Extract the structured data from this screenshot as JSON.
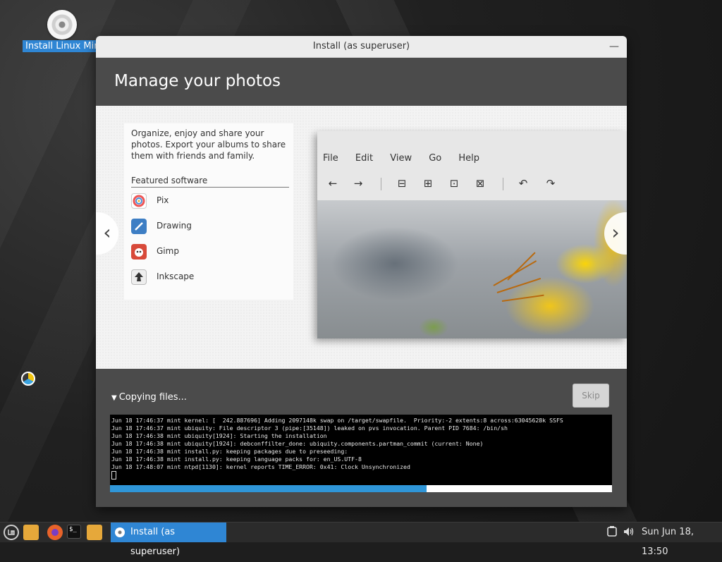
{
  "desktop": {
    "icon_label": "Install Linux Mint"
  },
  "window": {
    "title": "Install (as superuser)",
    "minimize_label": "—",
    "header_title": "Manage your photos"
  },
  "slide": {
    "description": "Organize, enjoy and share your photos. Export your albums to share them with friends and family.",
    "featured_title": "Featured software",
    "apps": [
      {
        "name": "Pix",
        "icon": "pix-icon"
      },
      {
        "name": "Drawing",
        "icon": "drawing-icon"
      },
      {
        "name": "Gimp",
        "icon": "gimp-icon"
      },
      {
        "name": "Inkscape",
        "icon": "inkscape-icon"
      }
    ],
    "mock_menu": [
      "File",
      "Edit",
      "View",
      "Go",
      "Help"
    ],
    "prev_label": "‹",
    "next_label": "›"
  },
  "progress": {
    "status": "Copying files...",
    "skip_label": "Skip",
    "percent": 63,
    "log": "Jun 18 17:46:37 mint kernel: [  242.887696] Adding 2097148k swap on /target/swapfile.  Priority:-2 extents:8 across:63045628k SSFS\nJun 18 17:46:37 mint ubiquity: File descriptor 3 (pipe:[35148]) leaked on pvs invocation. Parent PID 7684: /bin/sh\nJun 18 17:46:38 mint ubiquity[1924]: Starting the installation\nJun 18 17:46:38 mint ubiquity[1924]: debconffilter_done: ubiquity.components.partman_commit (current: None)\nJun 18 17:46:38 mint install.py: keeping packages due to preseeding:\nJun 18 17:46:38 mint install.py: keeping language packs for: en_US.UTF-8\nJun 18 17:48:07 mint ntpd[1130]: kernel reports TIME_ERROR: 0x41: Clock Unsynchronized"
  },
  "taskbar": {
    "task_label": "Install (as superuser)",
    "clock": "Sun Jun 18, 13:50",
    "terminal_glyph": "$_"
  },
  "colors": {
    "accent": "#2f86d4",
    "progress": "#2f96d8",
    "header_bg": "#4b4b4b"
  }
}
